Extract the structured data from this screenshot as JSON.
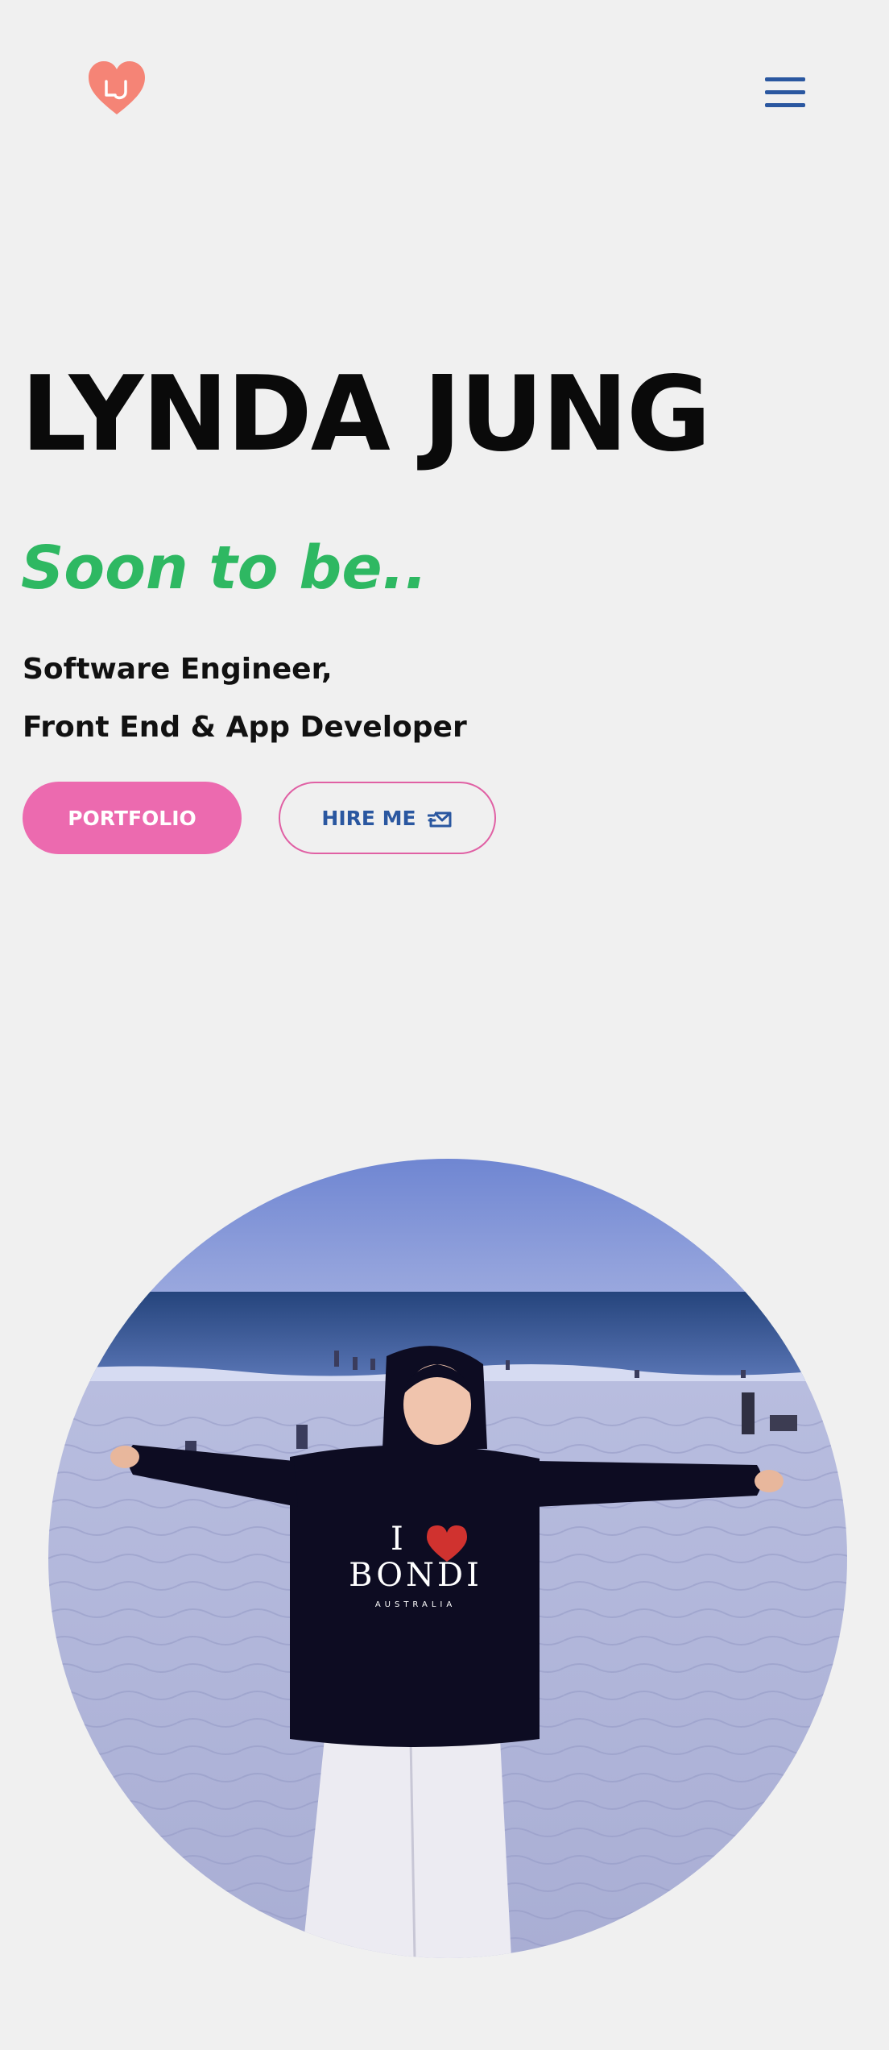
{
  "header": {
    "logo_icon": "heart-logo-icon",
    "logo_text": "LJ",
    "menu_icon": "hamburger-menu-icon"
  },
  "hero": {
    "name": "LYNDA JUNG",
    "tagline": "Soon to be..",
    "role_line_1": "Software Engineer,",
    "role_line_2": "Front End & App Developer"
  },
  "buttons": {
    "portfolio_label": "PORTFOLIO",
    "hire_label": "HIRE ME",
    "hire_icon": "envelope-icon"
  },
  "colors": {
    "background": "#f0f0f0",
    "logo": "#f58476",
    "menu": "#2a57a0",
    "tagline": "#2eb862",
    "portfolio_button": "#ec6aaf",
    "hire_border": "#e060a4",
    "hire_text": "#2a57a0"
  },
  "photo": {
    "subject": "profile-photo",
    "shirt_text": "BONDI",
    "shirt_subtext": "AUSTRALIA"
  }
}
